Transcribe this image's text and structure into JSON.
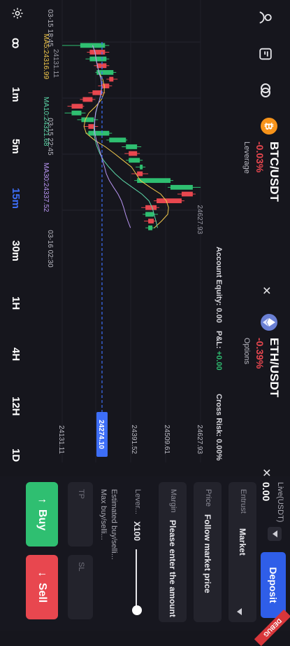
{
  "header": {
    "icons": [
      "person-icon",
      "sheet-icon",
      "link-icon"
    ],
    "tabs": [
      {
        "pair": "BTC/USDT",
        "change": "-0.03%",
        "sub": "Leverage",
        "coin": "bitcoin-icon"
      },
      {
        "pair": "ETH/USDT",
        "change": "-0.39%",
        "sub": "Options",
        "coin": "ethereum-icon"
      }
    ]
  },
  "account": {
    "equity_label": "Account Equity:",
    "equity_value": "0.00",
    "pnl_label": "P&L:",
    "pnl_value": "+0.00",
    "risk_label": "Cross Risk:",
    "risk_value": "0.00%"
  },
  "ma": {
    "ma5": "MA5:24316.99",
    "ma10": "MA10:24321.68",
    "ma30": "MA30:24337.52"
  },
  "chart": {
    "price_ticks": [
      "24627.93",
      "24509.61",
      "24391.52",
      "24274.10",
      "24131.11"
    ],
    "current_price": "24274.10",
    "time_ticks": [
      "03-15 18:45",
      "03-15 22:45",
      "03-16 02:30"
    ],
    "high_label": "24627.93",
    "low_label": "24131.11"
  },
  "chart_data": {
    "type": "candlestick",
    "candles": [
      [
        24196,
        24285,
        24131,
        24300
      ],
      [
        24285,
        24230,
        24220,
        24300
      ],
      [
        24230,
        24290,
        24215,
        24300
      ],
      [
        24290,
        24255,
        24245,
        24300
      ],
      [
        24255,
        24315,
        24250,
        24325
      ],
      [
        24315,
        24300,
        24290,
        24330
      ],
      [
        24300,
        24275,
        24260,
        24310
      ],
      [
        24275,
        24240,
        24225,
        24285
      ],
      [
        24240,
        24205,
        24195,
        24250
      ],
      [
        24205,
        24165,
        24150,
        24210
      ],
      [
        24165,
        24200,
        24140,
        24215
      ],
      [
        24200,
        24245,
        24185,
        24260
      ],
      [
        24245,
        24225,
        24210,
        24260
      ],
      [
        24225,
        24300,
        24215,
        24310
      ],
      [
        24300,
        24360,
        24290,
        24365
      ],
      [
        24360,
        24400,
        24345,
        24415
      ],
      [
        24400,
        24370,
        24355,
        24410
      ],
      [
        24370,
        24410,
        24360,
        24420
      ],
      [
        24410,
        24420,
        24395,
        24430
      ],
      [
        24420,
        24400,
        24380,
        24440
      ],
      [
        24400,
        24520,
        24390,
        24530
      ],
      [
        24520,
        24600,
        24510,
        24628
      ],
      [
        24600,
        24560,
        24545,
        24610
      ],
      [
        24560,
        24470,
        24460,
        24570
      ],
      [
        24470,
        24430,
        24415,
        24480
      ],
      [
        24430,
        24460,
        24420,
        24475
      ],
      [
        24460,
        24440,
        24425,
        24470
      ],
      [
        24440,
        24455,
        24430,
        24465
      ]
    ],
    "current_price": 24274.1,
    "ylim": [
      24131.11,
      24627.93
    ]
  },
  "timeframes": {
    "settings_icon": "settings-icon",
    "indicator": "ꝏ",
    "items": [
      "1m",
      "5m",
      "15m",
      "30m",
      "1H",
      "4H",
      "12H",
      "1D"
    ],
    "active": "15m"
  },
  "trade": {
    "live_label": "Live(USDT)",
    "live_value": "0.00",
    "deposit_label": "Deposit",
    "entrust_label": "Entrust",
    "entrust_value": "Market",
    "price_label": "Price",
    "price_value": "Follow market price",
    "margin_label": "Margin",
    "margin_placeholder": "Please enter the amount",
    "lever_label": "Lever...",
    "lever_value": "X100",
    "estimated": "Estimated buy/selli...",
    "max": "Max buy/selli...",
    "tp_label": "TP",
    "sl_label": "SL",
    "buy_label": "Buy",
    "sell_label": "Sell",
    "debug": "DEBUG"
  }
}
